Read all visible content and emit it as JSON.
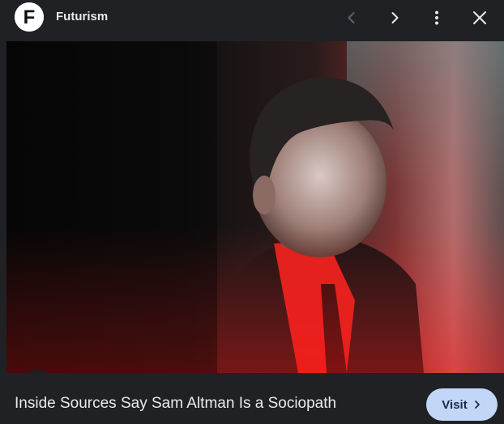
{
  "header": {
    "logo_letter": "F",
    "site_name": "Futurism",
    "icons": {
      "prev": "chevron-left-icon",
      "next": "chevron-right-icon",
      "more": "more-vertical-icon",
      "close": "close-icon"
    }
  },
  "image": {
    "icon": "photo",
    "lens_icon": "lens-icon"
  },
  "footer": {
    "title": "Inside Sources Say Sam Altman Is a Sociopath",
    "visit_label": "Visit",
    "visit_icon": "chevron-right-icon",
    "visit_color": "#c2d6f7"
  }
}
